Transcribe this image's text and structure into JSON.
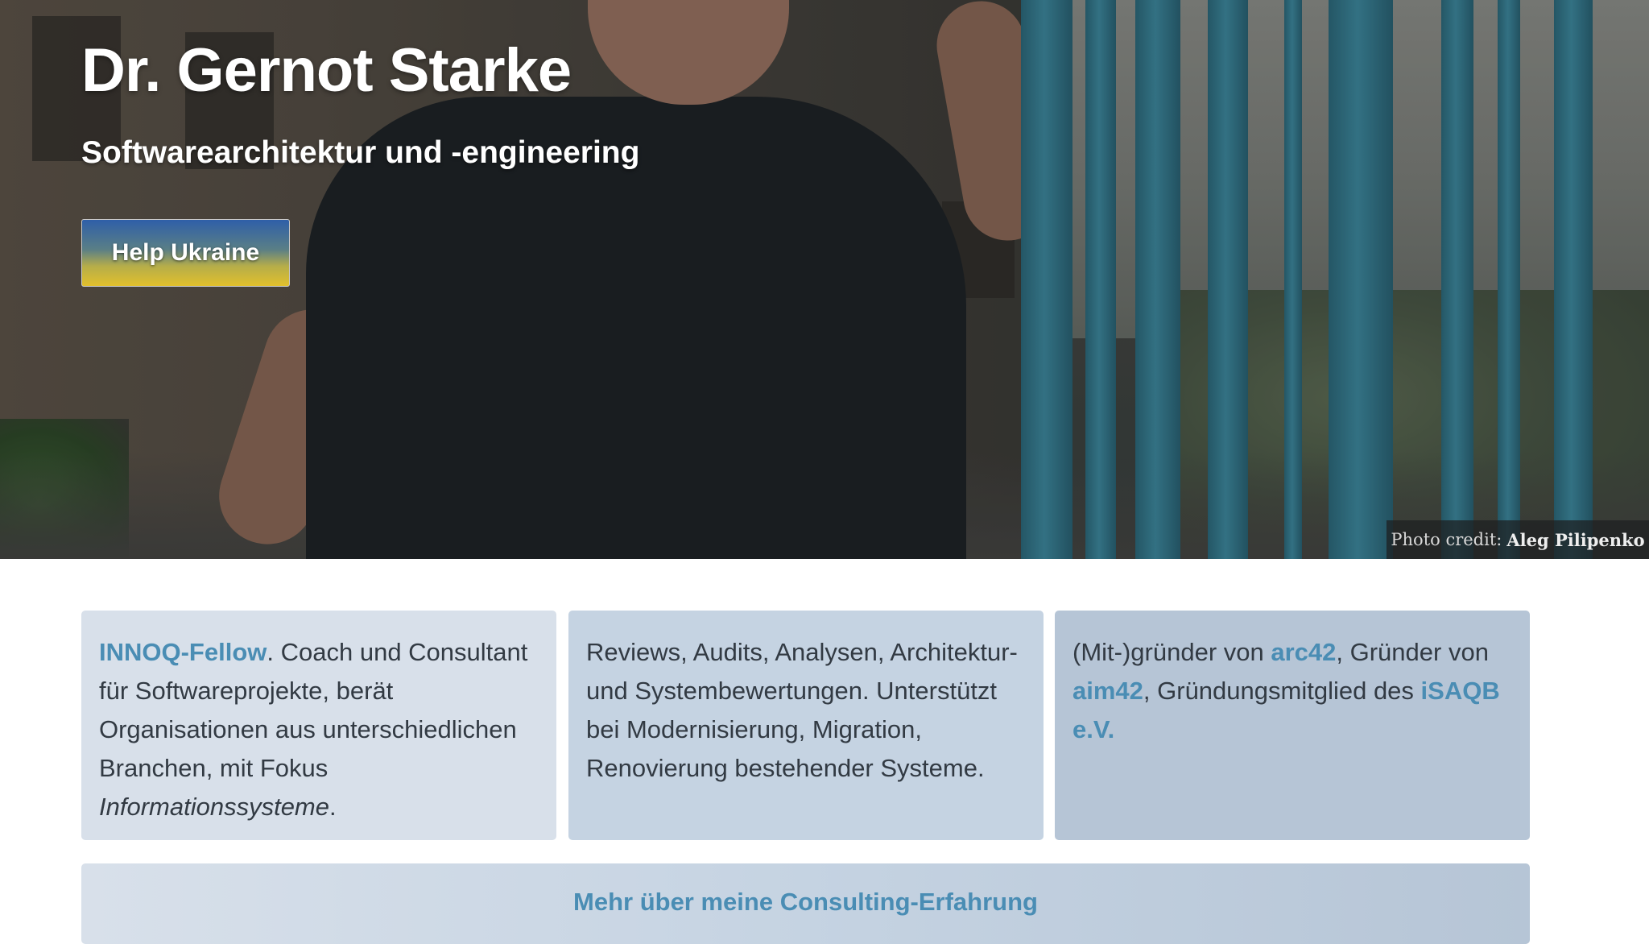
{
  "hero": {
    "title": "Dr. Gernot Starke",
    "subtitle": "Softwarearchitektur und -engineering",
    "ukraine_button": "Help Ukraine",
    "photo_credit_label": "Photo credit:",
    "photo_credit_name": "Aleg Pilipenko"
  },
  "cards": [
    {
      "link": "INNOQ-Fellow",
      "text": ". Coach und Consultant für Softwareprojekte, berät Organisationen aus unterschiedlichen Branchen, mit Fokus ",
      "emphasis": "Informationssysteme",
      "end": "."
    },
    {
      "text": "Reviews, Audits, Analysen, Architektur- und Systembewertungen. Unterstützt bei Modernisierung, Migration, Renovierung bestehender Systeme."
    },
    {
      "prefix": "(Mit-)gründer von ",
      "link1": "arc42",
      "middle": ", Gründer von ",
      "link2": "aim42",
      "middle2": ", Gründungsmitglied des ",
      "link3": "iSAQB e.V."
    }
  ],
  "more_button": "Mehr über meine Consulting-Erfahrung",
  "colors": {
    "link": "#4a8db4",
    "card1": "#d8e0ea",
    "card2": "#c5d3e2",
    "card3": "#b6c5d6",
    "ukraine_blue": "#2f5fa8",
    "ukraine_yellow": "#e2c02c"
  }
}
